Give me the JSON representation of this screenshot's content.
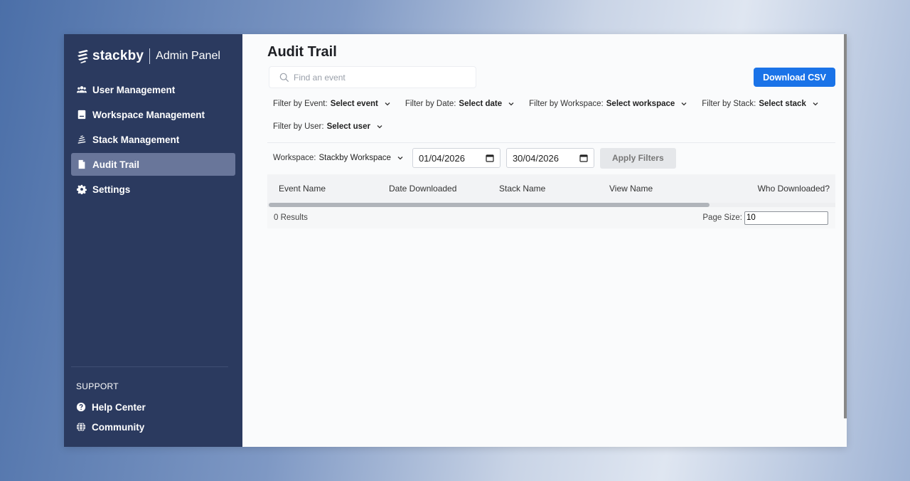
{
  "brand": {
    "logo_text": "stackby",
    "panel_label": "Admin Panel"
  },
  "sidebar": {
    "items": [
      {
        "label": "User Management",
        "icon": "users-icon"
      },
      {
        "label": "Workspace Management",
        "icon": "workspace-icon"
      },
      {
        "label": "Stack Management",
        "icon": "stack-icon"
      },
      {
        "label": "Audit Trail",
        "icon": "document-icon",
        "active": true
      },
      {
        "label": "Settings",
        "icon": "gear-icon"
      }
    ],
    "support": {
      "title": "SUPPORT",
      "items": [
        {
          "label": "Help Center",
          "icon": "help-icon"
        },
        {
          "label": "Community",
          "icon": "globe-icon"
        }
      ]
    }
  },
  "main": {
    "title": "Audit Trail",
    "search": {
      "placeholder": "Find an event",
      "value": ""
    },
    "download_button": "Download CSV",
    "filters": [
      {
        "label": "Filter by Event:",
        "value": "Select event"
      },
      {
        "label": "Filter by Date:",
        "value": "Select date"
      },
      {
        "label": "Filter by Workspace:",
        "value": "Select workspace"
      },
      {
        "label": "Filter by Stack:",
        "value": "Select stack"
      },
      {
        "label": "Filter by User:",
        "value": "Select user"
      }
    ],
    "workspace_filter": {
      "label": "Workspace:",
      "value": "Stackby Workspace"
    },
    "date_from": "01/04/2026",
    "date_to": "30/04/2026",
    "apply_button": "Apply Filters",
    "table": {
      "columns": [
        "Event Name",
        "Date Downloaded",
        "Stack Name",
        "View Name",
        "Who Downloaded?"
      ],
      "rows": [],
      "results_text": "0 Results",
      "page_size_label": "Page Size:",
      "page_size_value": "10"
    }
  },
  "colors": {
    "sidebar_bg": "#2b3a5f",
    "sidebar_active": "#69769a",
    "primary": "#1a73e8",
    "page_bg": "#fafbfc"
  }
}
